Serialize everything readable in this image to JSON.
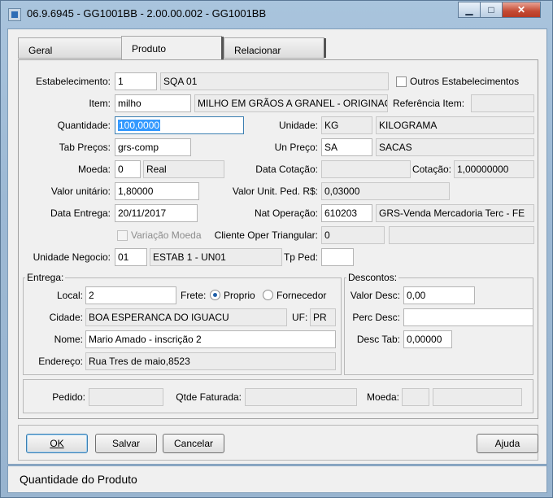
{
  "window": {
    "title": "06.9.6945 - GG1001BB - 2.00.00.002 - GG1001BB",
    "minimize": "▁",
    "maximize": "□",
    "close": "✕"
  },
  "tabs": [
    {
      "label": "Geral"
    },
    {
      "label": "Produto"
    },
    {
      "label": "Relacionar"
    }
  ],
  "form": {
    "estabelecimento": {
      "label": "Estabelecimento:",
      "code": "1",
      "name": "SQA 01"
    },
    "outros_estab": {
      "label": "Outros Estabelecimentos"
    },
    "item": {
      "label": "Item:",
      "code": "milho",
      "desc": "MILHO EM GRÃOS A GRANEL - ORIGINAÇÃ"
    },
    "referencia_item": {
      "label": "Referência Item:",
      "value": ""
    },
    "quantidade": {
      "label": "Quantidade:",
      "value": "100,0000"
    },
    "unidade": {
      "label": "Unidade:",
      "code": "KG",
      "desc": "KILOGRAMA"
    },
    "tab_precos": {
      "label": "Tab Preços:",
      "value": "grs-comp"
    },
    "un_preco": {
      "label": "Un Preço:",
      "code": "SA",
      "desc": "SACAS"
    },
    "moeda": {
      "label": "Moeda:",
      "code": "0",
      "desc": "Real"
    },
    "data_cotacao": {
      "label": "Data Cotação:",
      "value": ""
    },
    "cotacao": {
      "label": "Cotação:",
      "value": "1,00000000"
    },
    "valor_unitario": {
      "label": "Valor unitário:",
      "value": "1,80000"
    },
    "valor_unit_ped": {
      "label": "Valor Unit. Ped. R$:",
      "value": "0,03000"
    },
    "data_entrega": {
      "label": "Data Entrega:",
      "value": "20/11/2017"
    },
    "nat_operacao": {
      "label": "Nat Operação:",
      "code": "610203",
      "desc": "GRS-Venda Mercadoria Terc - FE"
    },
    "variacao_moeda": {
      "label": "Variação Moeda"
    },
    "cliente_oper": {
      "label": "Cliente Oper Triangular:",
      "code": "0",
      "desc": ""
    },
    "unidade_negocio": {
      "label": "Unidade Negocio:",
      "code": "01",
      "desc": "ESTAB 1 - UN01"
    },
    "tp_ped": {
      "label": "Tp Ped:",
      "value": ""
    }
  },
  "entrega": {
    "title": "Entrega:",
    "local": {
      "label": "Local:",
      "value": "2"
    },
    "frete": {
      "label": "Frete:",
      "opt1": "Proprio",
      "opt2": "Fornecedor"
    },
    "cidade": {
      "label": "Cidade:",
      "value": "BOA ESPERANCA DO IGUACU"
    },
    "uf": {
      "label": "UF:",
      "value": "PR"
    },
    "nome": {
      "label": "Nome:",
      "value": "Mario Amado - inscrição 2"
    },
    "endereco": {
      "label": "Endereço:",
      "value": "Rua Tres de maio,8523"
    }
  },
  "descontos": {
    "title": "Descontos:",
    "valor_desc": {
      "label": "Valor Desc:",
      "value": "0,00"
    },
    "perc_desc": {
      "label": "Perc Desc:",
      "value": ""
    },
    "desc_tab": {
      "label": "Desc Tab:",
      "value": "0,00000"
    }
  },
  "pedido_row": {
    "pedido": {
      "label": "Pedido:",
      "value": ""
    },
    "qtde_faturada": {
      "label": "Qtde Faturada:",
      "value": ""
    },
    "moeda": {
      "label": "Moeda:",
      "code": "",
      "desc": ""
    }
  },
  "buttons": {
    "ok": "OK",
    "salvar": "Salvar",
    "cancelar": "Cancelar",
    "ajuda": "Ajuda"
  },
  "status": "Quantidade do Produto"
}
